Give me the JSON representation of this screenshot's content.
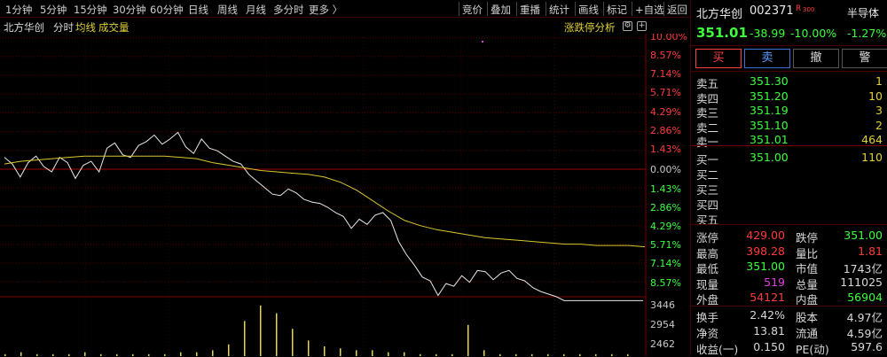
{
  "toolbar": {
    "periods": [
      "1分钟",
      "5分钟",
      "15分钟",
      "30分钟",
      "60分钟",
      "日线",
      "周线",
      "月线",
      "多分时",
      "更多 〉"
    ],
    "actions": [
      "竞价",
      "叠加",
      "重播",
      "统计",
      "画线",
      "标记",
      "+自选",
      "返回"
    ]
  },
  "chart_header": {
    "name": "北方华创",
    "mode": "分时",
    "avg_label": "均线",
    "vol_label": "成交量",
    "analysis": "涨跌停分析"
  },
  "chart_data": {
    "type": "line",
    "price_axis": [
      "10.00%",
      "8.57%",
      "7.14%",
      "5.71%",
      "4.29%",
      "2.86%",
      "1.43%",
      "0.00%",
      "1.43%",
      "2.86%",
      "4.29%",
      "5.71%",
      "7.14%",
      "8.57%"
    ],
    "volume_axis": [
      "3446",
      "2954",
      "2462"
    ],
    "series": [
      {
        "values": [
          0.9,
          0.4,
          -0.6,
          0.5,
          1.0,
          0.2,
          -0.2,
          0.9,
          0.5,
          -0.7,
          0.3,
          0.6,
          -0.2,
          1.6,
          2.0,
          1.1,
          0.9,
          1.8,
          2.1,
          2.6,
          1.9,
          2.3,
          2.8,
          1.7,
          1.2,
          2.3,
          1.6,
          1.4,
          1.0,
          0.6,
          0.4,
          -0.4,
          -0.9,
          -1.4,
          -1.9,
          -2.0,
          -1.5,
          -1.8,
          -2.3,
          -2.5,
          -2.6,
          -2.9,
          -3.3,
          -3.6,
          -4.5,
          -3.8,
          -4.2,
          -3.5,
          -3.3,
          -3.9,
          -5.5,
          -6.5,
          -7.3,
          -8.2,
          -8.5,
          -9.6,
          -8.7,
          -8.9,
          -8.1,
          -8.6,
          -7.7,
          -7.8,
          -8.4,
          -7.9,
          -7.7,
          -8.3,
          -8.5,
          -9.0,
          -9.3,
          -9.5,
          -9.7,
          -10.0,
          -10.0,
          -10.0,
          -10.0,
          -10.0,
          -10.0,
          -10.0,
          -10.0,
          -10.0,
          -10.0,
          -10.0
        ]
      },
      {
        "values": [
          0.4,
          0.6,
          0.7,
          0.8,
          0.9,
          1.0,
          1.0,
          1.0,
          1.0,
          1.0,
          1.0,
          0.9,
          0.8,
          0.5,
          0.3,
          0.1,
          -0.1,
          -0.2,
          -0.3,
          -0.4,
          -0.6,
          -1.0,
          -1.6,
          -2.4,
          -3.2,
          -3.9,
          -4.3,
          -4.6,
          -4.8,
          -5.0,
          -5.2,
          -5.3,
          -5.4,
          -5.5,
          -5.6,
          -5.7,
          -5.7,
          -5.8,
          -5.8,
          -5.8,
          -5.9
        ]
      }
    ],
    "volume": [
      0.1,
      0.2,
      0.1,
      0.1,
      0.1,
      0.2,
      0.1,
      0.1,
      0.1,
      0.1,
      0.1,
      0.2,
      0.2,
      0.3,
      0.6,
      1.8,
      2.6,
      2.2,
      1.4,
      0.8,
      0.5,
      0.4,
      0.3,
      0.3,
      0.2,
      0.2,
      0.1,
      0.1,
      0.1,
      1.6,
      0.3,
      0.1,
      0.1,
      0.1,
      0.1,
      0.1,
      0.1,
      0.1,
      0.1,
      0.1
    ]
  },
  "quote": {
    "name": "北方华创",
    "code": "002371",
    "tag": "R",
    "tag_sub": "300",
    "sector": "半导体",
    "price": "351.01",
    "change": "-38.99",
    "change_pct": "-10.00%",
    "sector_pct": "-1.27%"
  },
  "buttons": {
    "buy": "买",
    "sell": "卖",
    "cancel": "撤",
    "alert": "警"
  },
  "asks": [
    {
      "label": "卖五",
      "price": "351.30",
      "vol": "1"
    },
    {
      "label": "卖四",
      "price": "351.20",
      "vol": "10"
    },
    {
      "label": "卖三",
      "price": "351.19",
      "vol": "3"
    },
    {
      "label": "卖二",
      "price": "351.10",
      "vol": "2"
    },
    {
      "label": "卖一",
      "price": "351.01",
      "vol": "464"
    }
  ],
  "bids": [
    {
      "label": "买一",
      "price": "351.00",
      "vol": "110"
    },
    {
      "label": "买二",
      "price": "",
      "vol": ""
    },
    {
      "label": "买三",
      "price": "",
      "vol": ""
    },
    {
      "label": "买四",
      "price": "",
      "vol": ""
    },
    {
      "label": "买五",
      "price": "",
      "vol": ""
    }
  ],
  "stats1": [
    {
      "l1": "涨停",
      "v1": "429.00",
      "c1": "#ff3c3c",
      "l2": "跌停",
      "v2": "351.00",
      "c2": "#3cff3c"
    },
    {
      "l1": "最高",
      "v1": "398.28",
      "c1": "#ff3c3c",
      "l2": "量比",
      "v2": "1.81",
      "c2": "#ff3c3c"
    },
    {
      "l1": "最低",
      "v1": "351.00",
      "c1": "#3cff3c",
      "l2": "市值",
      "v2": "1743亿",
      "c2": "#d8d8d8"
    },
    {
      "l1": "现量",
      "v1": "519",
      "c1": "#e040e0",
      "l2": "总量",
      "v2": "111025",
      "c2": "#d8d8d8"
    },
    {
      "l1": "外盘",
      "v1": "54121",
      "c1": "#ff3c3c",
      "l2": "内盘",
      "v2": "56904",
      "c2": "#3cff3c"
    }
  ],
  "stats2": [
    {
      "l1": "换手",
      "v1": "2.42%",
      "l2": "股本",
      "v2": "4.97亿"
    },
    {
      "l1": "净资",
      "v1": "13.81",
      "l2": "流通",
      "v2": "4.59亿"
    },
    {
      "l1": "收益(一)",
      "v1": "0.150",
      "l2": "PE(动)",
      "v2": "597.6"
    }
  ]
}
